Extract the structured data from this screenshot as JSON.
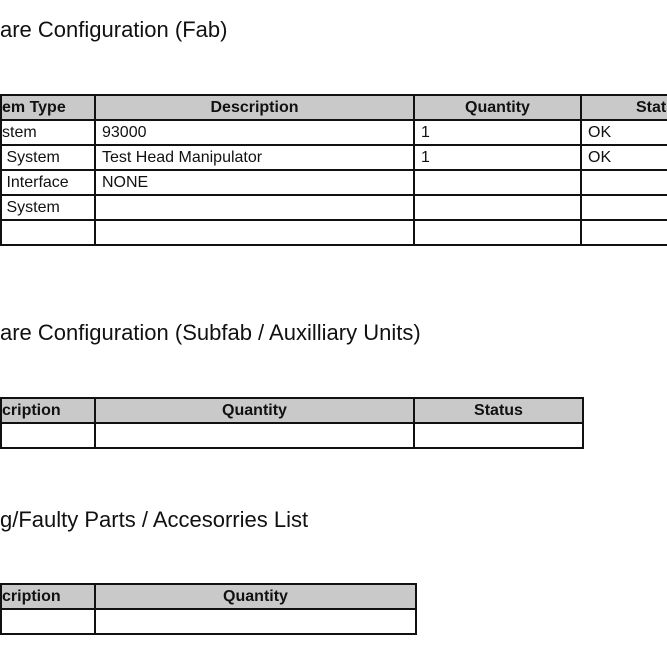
{
  "sections": [
    {
      "title": "are Configuration (Fab)",
      "headers": [
        "em Type",
        "Description",
        "Quantity",
        "Stat"
      ],
      "rows": [
        [
          "stem",
          "93000",
          "1",
          "OK"
        ],
        [
          " System",
          "Test Head Manipulator",
          "1",
          "OK"
        ],
        [
          " Interface",
          "NONE",
          "",
          ""
        ],
        [
          " System",
          "",
          "",
          ""
        ],
        [
          "",
          "",
          "",
          ""
        ]
      ]
    },
    {
      "title": "are Configuration (Subfab / Auxilliary Units)",
      "headers": [
        "cription",
        "Quantity",
        "Status"
      ],
      "rows": [
        [
          "",
          "",
          ""
        ]
      ]
    },
    {
      "title": "g/Faulty Parts / Accesorries List",
      "headers": [
        "cription",
        "Quantity"
      ],
      "rows": [
        [
          "",
          ""
        ]
      ]
    }
  ]
}
